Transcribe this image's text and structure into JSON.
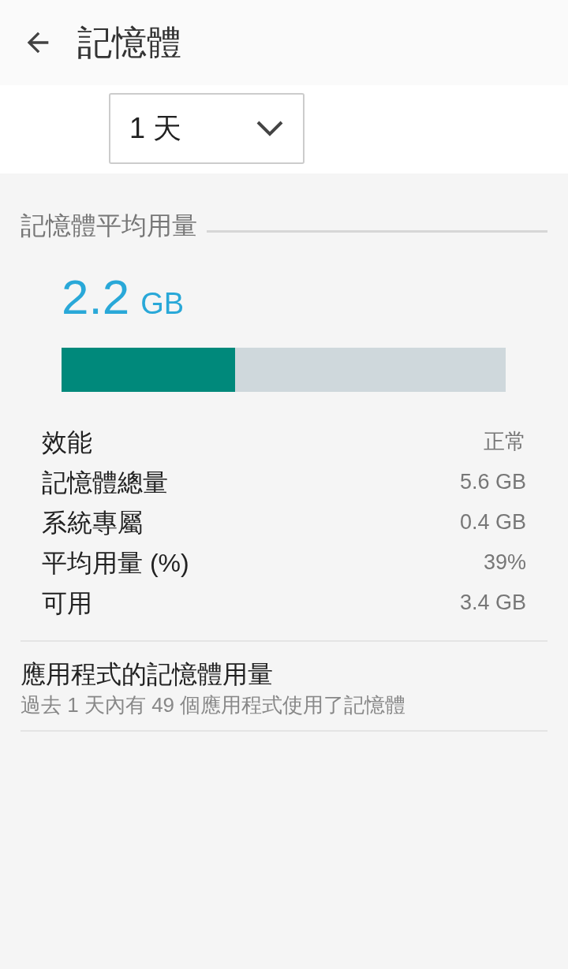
{
  "app_bar": {
    "title": "記憶體"
  },
  "period_dropdown": {
    "value": "1 天"
  },
  "average_section": {
    "header": "記憶體平均用量",
    "amount": "2.2",
    "unit": "GB",
    "level": 0.39
  },
  "stats": [
    {
      "label": "效能",
      "value": "正常"
    },
    {
      "label": "記憶體總量",
      "value": "5.6 GB"
    },
    {
      "label": "系統專屬",
      "value": "0.4 GB"
    },
    {
      "label": "平均用量 (%)",
      "value": "39%"
    },
    {
      "label": "可用",
      "value": "3.4 GB"
    }
  ],
  "apps_item": {
    "title": "應用程式的記憶體用量",
    "subtitle": "過去 1 天內有 49 個應用程式使用了記憶體"
  }
}
